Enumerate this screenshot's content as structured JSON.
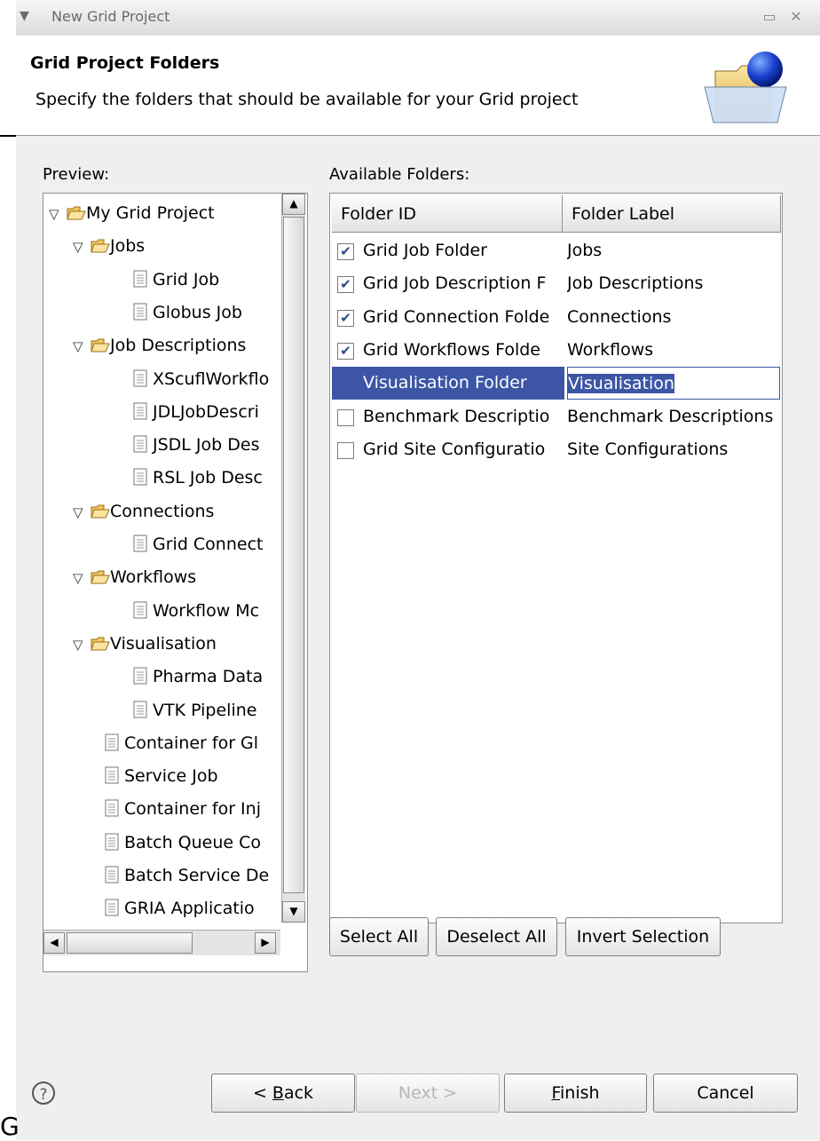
{
  "window": {
    "title": "New Grid Project"
  },
  "header": {
    "title": "Grid Project Folders",
    "description": "Specify the folders that should be available for your Grid project"
  },
  "preview": {
    "label": "Preview:",
    "tree": [
      {
        "label": "My Grid Project",
        "type": "folder",
        "depth": 0,
        "expanded": true
      },
      {
        "label": "Jobs",
        "type": "folder",
        "depth": 1,
        "expanded": true
      },
      {
        "label": "Grid Job",
        "type": "file",
        "depth": 2
      },
      {
        "label": "Globus Job",
        "type": "file",
        "depth": 2
      },
      {
        "label": "Job Descriptions",
        "type": "folder",
        "depth": 1,
        "expanded": true
      },
      {
        "label": "XScuflWorkflo",
        "type": "file",
        "depth": 2
      },
      {
        "label": "JDLJobDescri",
        "type": "file",
        "depth": 2
      },
      {
        "label": "JSDL Job Des",
        "type": "file",
        "depth": 2
      },
      {
        "label": "RSL Job Desc",
        "type": "file",
        "depth": 2
      },
      {
        "label": "Connections",
        "type": "folder",
        "depth": 1,
        "expanded": true
      },
      {
        "label": "Grid Connect",
        "type": "file",
        "depth": 2
      },
      {
        "label": "Workflows",
        "type": "folder",
        "depth": 1,
        "expanded": true
      },
      {
        "label": "Workflow Mc",
        "type": "file",
        "depth": 2
      },
      {
        "label": "Visualisation",
        "type": "folder",
        "depth": 1,
        "expanded": true
      },
      {
        "label": "Pharma Data",
        "type": "file",
        "depth": 2
      },
      {
        "label": "VTK Pipeline",
        "type": "file",
        "depth": 2
      },
      {
        "label": "Container for Gl",
        "type": "file",
        "depth": 1
      },
      {
        "label": "Service Job",
        "type": "file",
        "depth": 1
      },
      {
        "label": "Container for Inj",
        "type": "file",
        "depth": 1
      },
      {
        "label": "Batch Queue Co",
        "type": "file",
        "depth": 1
      },
      {
        "label": "Batch Service De",
        "type": "file",
        "depth": 1
      },
      {
        "label": "GRIA  Applicatio",
        "type": "file",
        "depth": 1
      }
    ]
  },
  "folders": {
    "label": "Available Folders:",
    "columns": [
      "Folder ID",
      "Folder Label"
    ],
    "rows": [
      {
        "id": "Grid Job Folder",
        "label": "Jobs",
        "checked": true,
        "selected": false
      },
      {
        "id": "Grid Job Description F",
        "label": "Job Descriptions",
        "checked": true,
        "selected": false
      },
      {
        "id": "Grid Connection Folde",
        "label": "Connections",
        "checked": true,
        "selected": false
      },
      {
        "id": "Grid Workflows Folde",
        "label": "Workflows",
        "checked": true,
        "selected": false
      },
      {
        "id": "Visualisation Folder",
        "label": "Visualisation",
        "checked": true,
        "selected": true
      },
      {
        "id": "Benchmark Descriptio",
        "label": "Benchmark Descriptions",
        "checked": false,
        "selected": false
      },
      {
        "id": "Grid Site Configuratio",
        "label": "Site Configurations",
        "checked": false,
        "selected": false
      }
    ],
    "select_all": "Select All",
    "deselect_all": "Deselect All",
    "invert_selection": "Invert Selection"
  },
  "footer": {
    "help": "?",
    "back_label": "< Back",
    "back_mnemonic": "B",
    "next_label": "Next >",
    "finish_label": "Finish",
    "finish_mnemonic": "F",
    "cancel_label": "Cancel"
  },
  "stray_text": "G",
  "colors": {
    "selection": "#3c56a5",
    "dialog_bg": "#efefef"
  }
}
